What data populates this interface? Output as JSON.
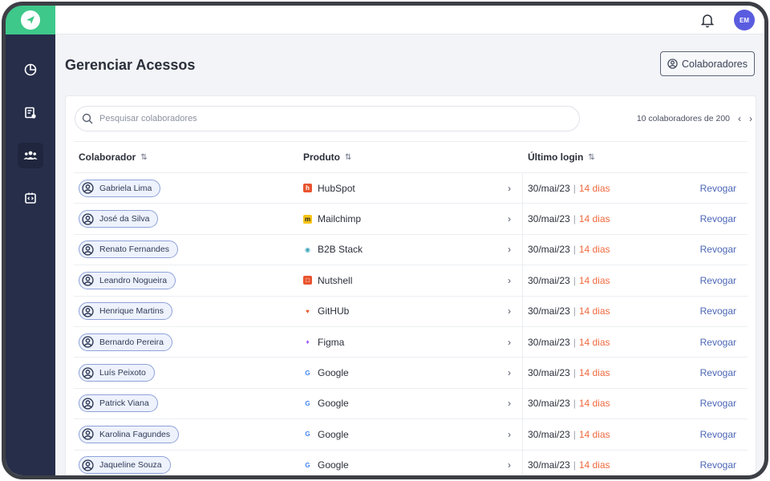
{
  "app": {
    "avatar_initials": "EM",
    "accent": "#3ec88a",
    "sidebar_bg": "#262e4a"
  },
  "sidebar": {
    "items": [
      {
        "icon": "pie-chart-icon"
      },
      {
        "icon": "document-settings-icon"
      },
      {
        "icon": "users-icon",
        "active": true
      },
      {
        "icon": "code-box-icon"
      }
    ]
  },
  "header": {
    "title": "Gerenciar Acessos",
    "collab_button": "Colaboradores"
  },
  "search": {
    "placeholder": "Pesquisar colaboradores"
  },
  "pagination": {
    "summary": "10 colaboradores de 200",
    "prev": "‹",
    "next": "›"
  },
  "table": {
    "columns": [
      "Colaborador",
      "Produto",
      "Último login"
    ],
    "revoke_label": "Revogar",
    "rows": [
      {
        "name": "Gabriela Lima",
        "product": "HubSpot",
        "product_icon": "hubspot-icon",
        "date": "30/mai/23",
        "days": "14 dias"
      },
      {
        "name": "José da Silva",
        "product": "Mailchimp",
        "product_icon": "mailchimp-icon",
        "date": "30/mai/23",
        "days": "14 dias"
      },
      {
        "name": "Renato Fernandes",
        "product": "B2B Stack",
        "product_icon": "b2b-stack-icon",
        "date": "30/mai/23",
        "days": "14 dias"
      },
      {
        "name": "Leandro Nogueira",
        "product": "Nutshell",
        "product_icon": "nutshell-icon",
        "date": "30/mai/23",
        "days": "14 dias"
      },
      {
        "name": "Henrique Martins",
        "product": "GitHUb",
        "product_icon": "gitlab-icon",
        "date": "30/mai/23",
        "days": "14 dias"
      },
      {
        "name": "Bernardo Pereira",
        "product": "Figma",
        "product_icon": "figma-icon",
        "date": "30/mai/23",
        "days": "14 dias"
      },
      {
        "name": "Luís Peixoto",
        "product": "Google",
        "product_icon": "google-icon",
        "date": "30/mai/23",
        "days": "14 dias"
      },
      {
        "name": "Patrick Viana",
        "product": "Google",
        "product_icon": "google-icon",
        "date": "30/mai/23",
        "days": "14 dias"
      },
      {
        "name": "Karolina Fagundes",
        "product": "Google",
        "product_icon": "google-icon",
        "date": "30/mai/23",
        "days": "14 dias"
      },
      {
        "name": "Jaqueline Souza",
        "product": "Google",
        "product_icon": "google-icon",
        "date": "30/mai/23",
        "days": "14 dias"
      }
    ]
  }
}
